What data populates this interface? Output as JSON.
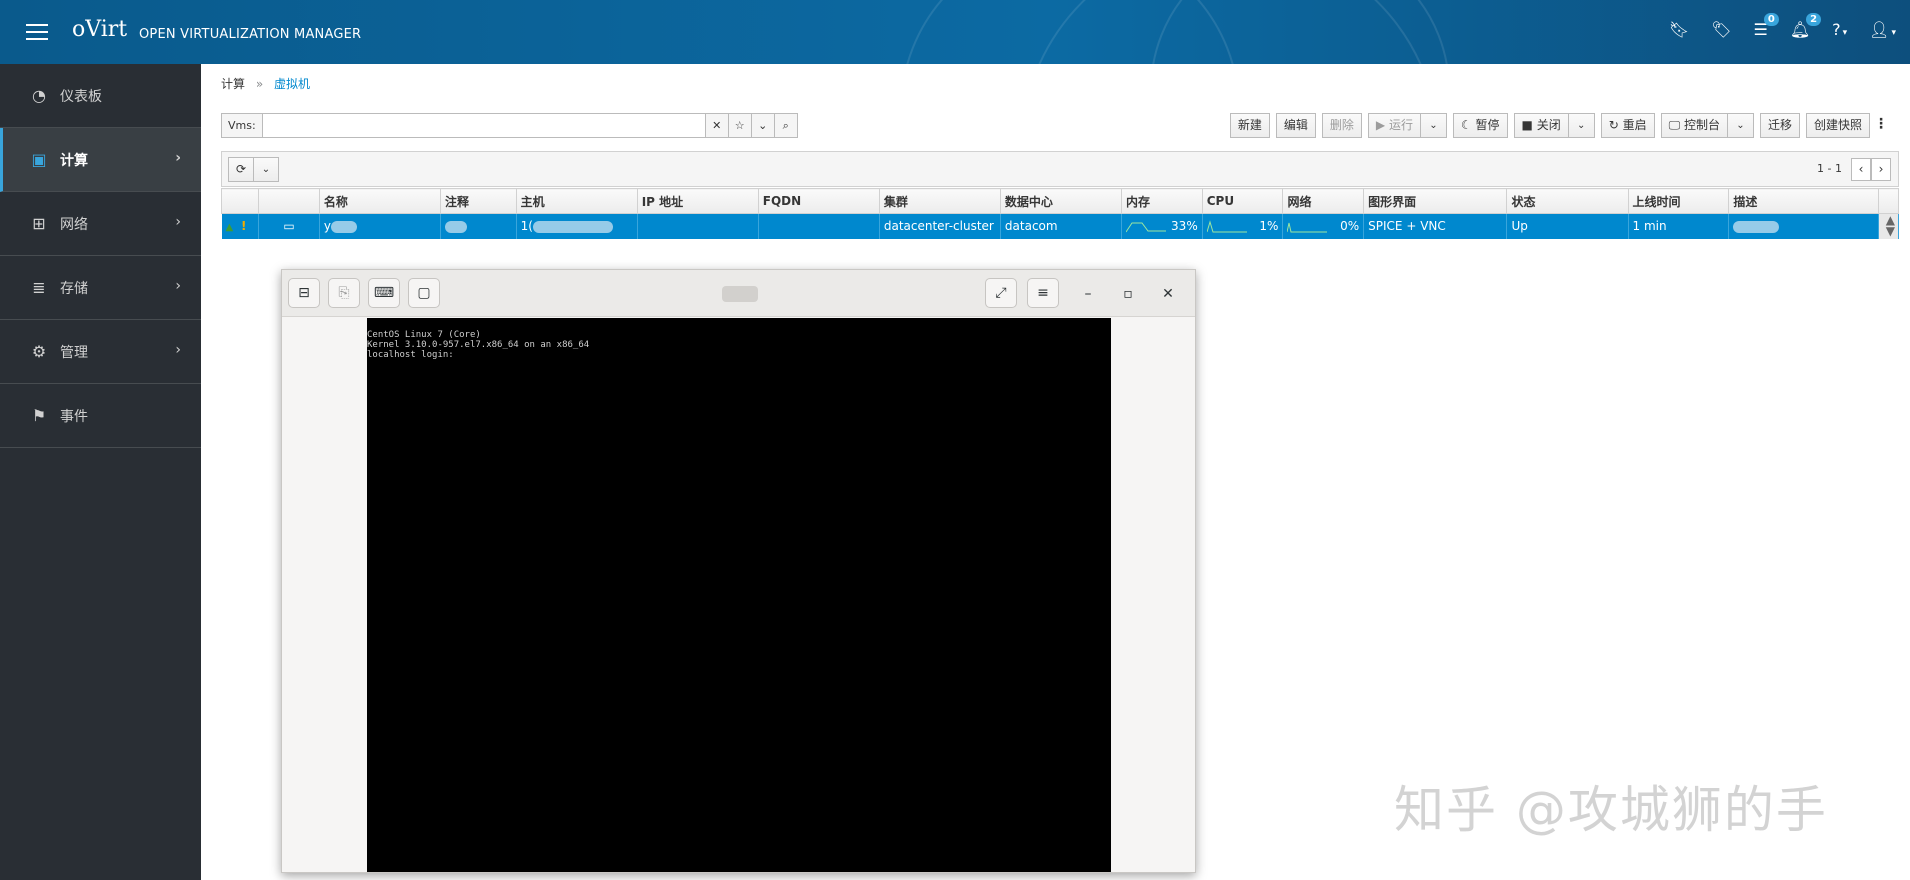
{
  "header": {
    "brand": "oVirt",
    "subtitle": "OPEN VIRTUALIZATION MANAGER",
    "tasks_count": "0",
    "events_count": "2"
  },
  "sidebar": {
    "items": [
      {
        "label": "仪表板",
        "icon": "dashboard-icon"
      },
      {
        "label": "计算",
        "icon": "cpu-icon"
      },
      {
        "label": "网络",
        "icon": "network-icon"
      },
      {
        "label": "存储",
        "icon": "storage-icon"
      },
      {
        "label": "管理",
        "icon": "gear-icon"
      },
      {
        "label": "事件",
        "icon": "flag-icon"
      }
    ]
  },
  "breadcrumb": {
    "parent": "计算",
    "sep": "»",
    "current": "虚拟机"
  },
  "search": {
    "label": "Vms:",
    "value": ""
  },
  "toolbar": {
    "new": "新建",
    "edit": "编辑",
    "delete": "删除",
    "run": "▶ 运行",
    "pause": "☾ 暂停",
    "shutdown": "■ 关闭",
    "reboot": "↻ 重启",
    "console": "🖵 控制台",
    "migrate": "迁移",
    "snapshot": "创建快照"
  },
  "pager": {
    "text": "1 - 1"
  },
  "table": {
    "columns": [
      "",
      "",
      "名称",
      "注释",
      "主机",
      "IP 地址",
      "FQDN",
      "集群",
      "数据中心",
      "内存",
      "CPU",
      "网络",
      "图形界面",
      "状态",
      "上线时间",
      "描述"
    ],
    "row": {
      "name": "y",
      "host": "1(",
      "cluster": "datacenter-cluster",
      "datacenter": "datacom",
      "memory": "33%",
      "cpu": "1%",
      "network": "0%",
      "graphics": "SPICE + VNC",
      "status": "Up",
      "uptime": "1 min"
    }
  },
  "console": {
    "lines": [
      "CentOS Linux 7 (Core)",
      "Kernel 3.10.0-957.el7.x86_64 on an x86_64",
      "",
      "localhost login:"
    ]
  },
  "watermark": "知乎 @攻城狮的手"
}
